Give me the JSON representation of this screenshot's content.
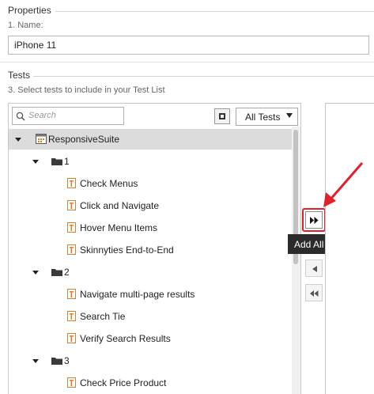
{
  "properties": {
    "title": "Properties",
    "name_label": "1. Name:",
    "name_value": "iPhone 11"
  },
  "tests": {
    "title": "Tests",
    "instruction": "3.  Select tests to include in your Test List",
    "search_placeholder": "Search",
    "filter_value": "All Tests",
    "tree": {
      "suite": "ResponsiveSuite",
      "folders": [
        {
          "label": "1",
          "items": [
            "Check Menus",
            "Click and Navigate",
            "Hover Menu Items",
            "Skinnyties End-to-End"
          ]
        },
        {
          "label": "2",
          "items": [
            "Navigate multi-page results",
            "Search Tie",
            "Verify Search Results"
          ]
        },
        {
          "label": "3",
          "items": [
            "Check Price Product"
          ]
        }
      ]
    }
  },
  "buttons": {
    "add_all_tooltip": "Add All"
  },
  "colors": {
    "highlight": "#e0202b",
    "tooltip_bg": "#2b2b2b",
    "test_icon": "#d9822b"
  }
}
